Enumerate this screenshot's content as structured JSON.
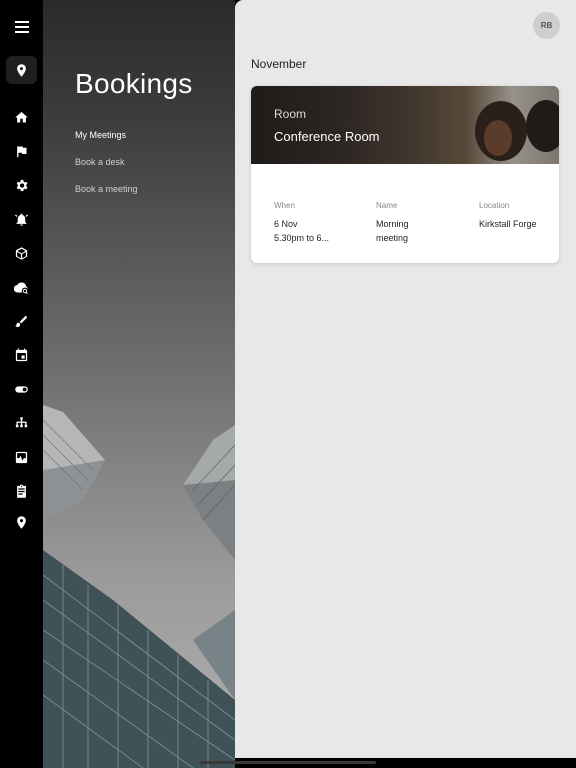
{
  "app": {
    "title": "Bookings",
    "user_initials": "RB"
  },
  "sidebar": {
    "icons": [
      "menu-icon",
      "location-pin-icon",
      "home-icon",
      "flag-icon",
      "gear-icon",
      "alarm-icon",
      "box-icon",
      "cloud-search-icon",
      "brush-icon",
      "calendar-icon",
      "toggle-icon",
      "sitemap-icon",
      "report-icon",
      "clipboard-icon",
      "map-pin-icon"
    ],
    "selected": "calendar-icon"
  },
  "sub_nav": {
    "items": [
      {
        "label": "My Meetings",
        "active": true
      },
      {
        "label": "Book a desk",
        "active": false
      },
      {
        "label": "Book a meeting",
        "active": false
      }
    ]
  },
  "main": {
    "month": "November",
    "card": {
      "type_label": "Room",
      "room_name": "Conference Room",
      "when_label": "When",
      "when_value_line1": "6 Nov",
      "when_value_line2": "5.30pm to 6...",
      "name_label": "Name",
      "name_value_line1": "Morning",
      "name_value_line2": "meeting",
      "location_label": "Location",
      "location_value": "Kirkstall Forge"
    }
  },
  "colors": {
    "rail_bg": "#000000",
    "content_bg": "#e8e8e8",
    "card_bg": "#ffffff"
  }
}
